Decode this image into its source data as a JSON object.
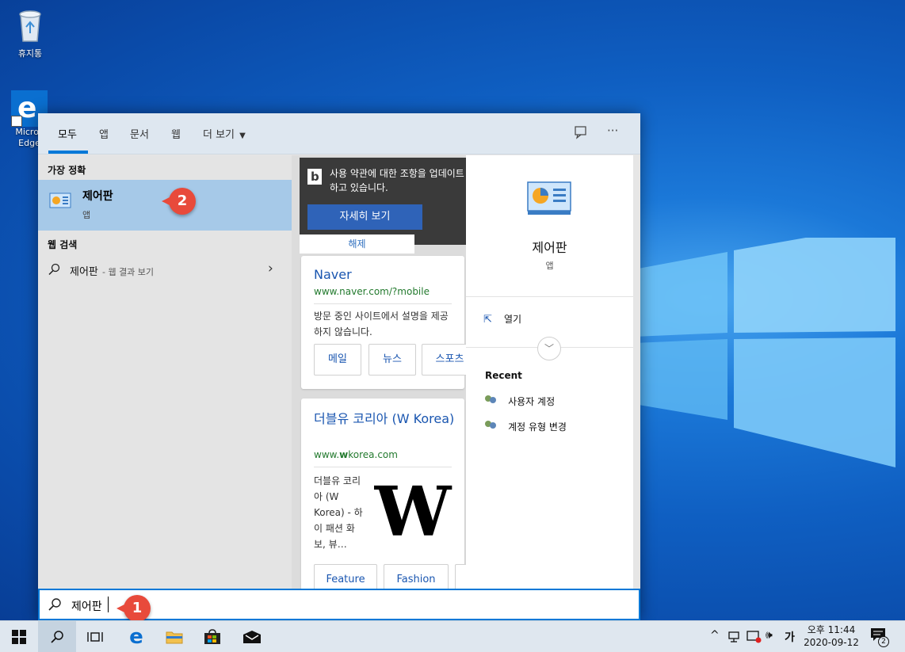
{
  "desktop": {
    "icons": [
      {
        "label": "휴지통"
      },
      {
        "label": "Micros Edge"
      }
    ]
  },
  "search_panel": {
    "tabs": [
      {
        "label": "모두"
      },
      {
        "label": "앱"
      },
      {
        "label": "문서"
      },
      {
        "label": "웹"
      },
      {
        "label": "더 보기"
      }
    ],
    "best_match": {
      "heading": "가장 정확",
      "title": "제어판",
      "subtitle": "앱"
    },
    "web_search": {
      "heading": "웹 검색",
      "query": "제어판",
      "suffix": "- 웹 결과 보기"
    },
    "bing_banner": {
      "text": "사용 약관에 대한 조항을 업데이트하고 있습니다.",
      "learn_more": "자세히 보기",
      "dismiss": "해제"
    },
    "cards": [
      {
        "title": "Naver",
        "url": "www.naver.com/?mobile",
        "description": "방문 중인 사이트에서 설명을 제공하지 않습니다.",
        "buttons": [
          "메일",
          "뉴스",
          "스포츠"
        ]
      },
      {
        "title": "더블유 코리아 (W Korea)",
        "url_pre": "www.",
        "url_bold": "w",
        "url_post": "korea.com",
        "description": "더블유 코리아 (W Korea) - 하이 패션 화보, 뷰…",
        "image_letter": "W",
        "buttons": [
          "Feature",
          "Fashion"
        ]
      }
    ],
    "detail": {
      "title": "제어판",
      "subtitle": "앱",
      "open_label": "열기",
      "recent_heading": "Recent",
      "recent_items": [
        "사용자 계정",
        "계정 유형 변경"
      ]
    },
    "search_input": {
      "value": "제어판"
    }
  },
  "markers": [
    {
      "label": "1"
    },
    {
      "label": "2"
    }
  ],
  "taskbar": {
    "ime_label": "가",
    "clock_period_time": "오후 11:44",
    "clock_date": "2020-09-12",
    "notification_count": "2"
  },
  "colors": {
    "accent": "#0078d7",
    "selection": "#a6c9e8",
    "marker": "#e84a3b",
    "link": "#1a56b0",
    "url": "#237a2e"
  }
}
